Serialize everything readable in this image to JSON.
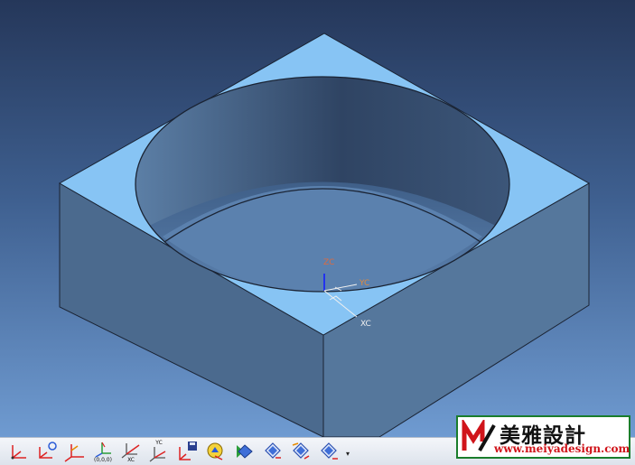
{
  "viewport": {
    "triad_labels": {
      "z": "ZC",
      "y": "YC",
      "x": "XC"
    }
  },
  "toolbar": {
    "buttons": [
      {
        "name": "csys-dynamic-button",
        "caption": ""
      },
      {
        "name": "csys-point-button",
        "caption": ""
      },
      {
        "name": "csys-origin-button",
        "caption": ""
      },
      {
        "name": "csys-absolute-origin-button",
        "caption": "(0,0,0)"
      },
      {
        "name": "csys-xc-button",
        "caption": "XC"
      },
      {
        "name": "csys-yc-button",
        "caption": "YC"
      },
      {
        "name": "csys-save-button",
        "caption": ""
      },
      {
        "name": "csys-wcs-button",
        "caption": ""
      },
      {
        "name": "view-orient-button",
        "caption": ""
      },
      {
        "name": "rotate-view-1-button",
        "caption": ""
      },
      {
        "name": "rotate-view-2-button",
        "caption": ""
      },
      {
        "name": "rotate-view-3-button",
        "caption": ""
      }
    ],
    "more_symbol": "▾"
  },
  "watermark": {
    "title": "美雅設計",
    "url": "www.meiyadesign.com"
  },
  "colors": {
    "face_top": "#87c4f4",
    "face_left": "#4b6a8e",
    "face_right": "#55779c",
    "edge": "#1a2333",
    "axis_z": "#2233ee",
    "axis_label_z": "#e06a3c",
    "axis_label_y": "#e08a3c",
    "watermark_border": "#1a7d2c",
    "watermark_url": "#d0141a"
  }
}
